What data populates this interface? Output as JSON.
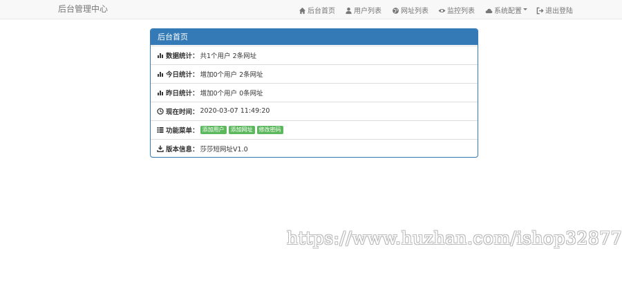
{
  "navbar": {
    "brand": "后台管理中心",
    "items": [
      {
        "label": "后台首页",
        "icon": "home-icon"
      },
      {
        "label": "用户列表",
        "icon": "user-icon"
      },
      {
        "label": "网址列表",
        "icon": "globe-icon"
      },
      {
        "label": "监控列表",
        "icon": "eye-icon"
      },
      {
        "label": "系统配置",
        "icon": "cloud-icon"
      },
      {
        "label": "退出登陆",
        "icon": "logout-icon"
      }
    ]
  },
  "panel": {
    "title": "后台首页",
    "rows": [
      {
        "label": "数据统计：",
        "value": "共1个用户 2条网址",
        "icon": "bar-chart-icon"
      },
      {
        "label": "今日统计：",
        "value": "增加0个用户 2条网址",
        "icon": "bar-chart-icon"
      },
      {
        "label": "昨日统计：",
        "value": "增加0个用户 0条网址",
        "icon": "bar-chart-icon"
      },
      {
        "label": "现在时间：",
        "value": "2020-03-07 11:49:20",
        "icon": "clock-icon"
      },
      {
        "label": "功能菜单：",
        "icon": "list-icon"
      },
      {
        "label": "版本信息：",
        "value": "莎莎短网址V1.0",
        "icon": "download-icon"
      }
    ],
    "menu_buttons": [
      "添加用户",
      "添加网址",
      "修改密码"
    ]
  },
  "watermark": "https://www.huzhan.com/ishop32877",
  "colors": {
    "primary": "#337ab7",
    "success": "#5cb85c",
    "navbar_bg": "#f8f8f8"
  }
}
